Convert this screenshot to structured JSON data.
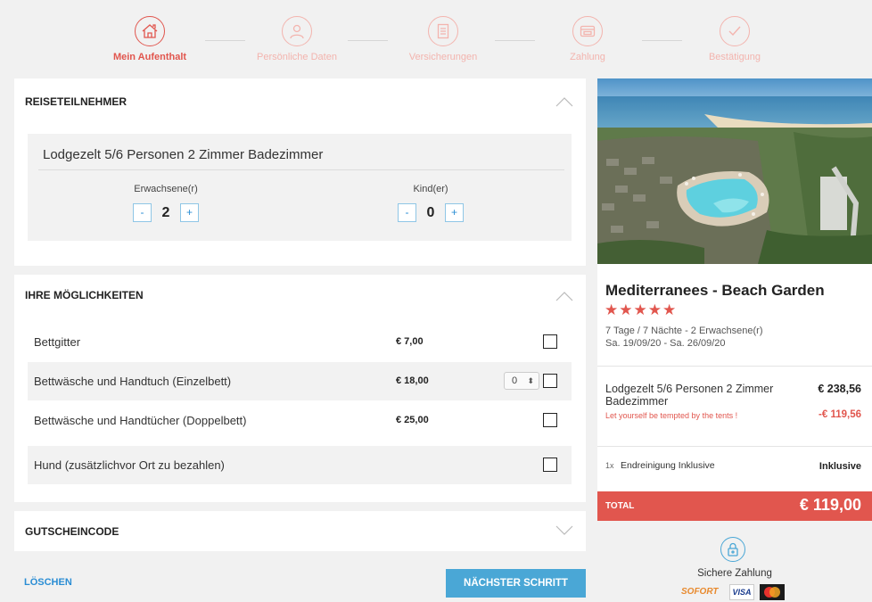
{
  "steps": [
    {
      "label": "Mein Aufenthalt",
      "icon": "house-icon",
      "active": true
    },
    {
      "label": "Persönliche Daten",
      "icon": "user-icon",
      "active": false
    },
    {
      "label": "Versicherungen",
      "icon": "document-icon",
      "active": false
    },
    {
      "label": "Zahlung",
      "icon": "card-icon",
      "active": false
    },
    {
      "label": "Bestätigung",
      "icon": "check-icon",
      "active": false
    }
  ],
  "participants": {
    "title": "REISETEILNEHMER",
    "room_name": "Lodgezelt 5/6 Personen 2 Zimmer Badezimmer",
    "adults_label": "Erwachsene(r)",
    "adults_value": "2",
    "children_label": "Kind(er)",
    "children_value": "0",
    "minus": "-",
    "plus": "+"
  },
  "options": {
    "title": "IHRE MÖGLICHKEITEN",
    "items": [
      {
        "name": "Bettgitter",
        "price": "€ 7,00",
        "checked": false
      },
      {
        "name": "Bettwäsche und Handtuch (Einzelbett)",
        "price": "€ 18,00",
        "quantity": "0",
        "checked": false
      },
      {
        "name": "Bettwäsche und Handtücher (Doppelbett)",
        "price": "€ 25,00",
        "checked": false
      },
      {
        "name": "Hund (zusätzlichvor Ort zu bezahlen)",
        "price": "",
        "checked": false
      }
    ]
  },
  "voucher": {
    "title": "GUTSCHEINCODE"
  },
  "actions": {
    "clear": "LÖSCHEN",
    "next": "NÄCHSTER SCHRITT"
  },
  "summary": {
    "camp_name": "Mediterranees - Beach Garden",
    "stars": "★★★★★",
    "duration": "7 Tage / 7 Nächte - 2 Erwachsene(r)",
    "dates": "Sa. 19/09/20 - Sa. 26/09/20",
    "room": "Lodgezelt 5/6 Personen 2 Zimmer Badezimmer",
    "room_price": "€ 238,56",
    "promo": "Let yourself be tempted by the tents !",
    "promo_value": "-€ 119,56",
    "cleaning_qty": "1x",
    "cleaning_label": "Endreinigung Inklusive",
    "cleaning_value": "Inklusive",
    "total_label": "TOTAL",
    "total_value": "€ 119,00"
  },
  "secure": {
    "label": "Sichere Zahlung",
    "logos": [
      "SOFORT",
      "VISA",
      "MasterCard"
    ]
  },
  "colors": {
    "accent": "#e1564e",
    "link": "#2a8dd4",
    "button": "#4aa7d6"
  }
}
